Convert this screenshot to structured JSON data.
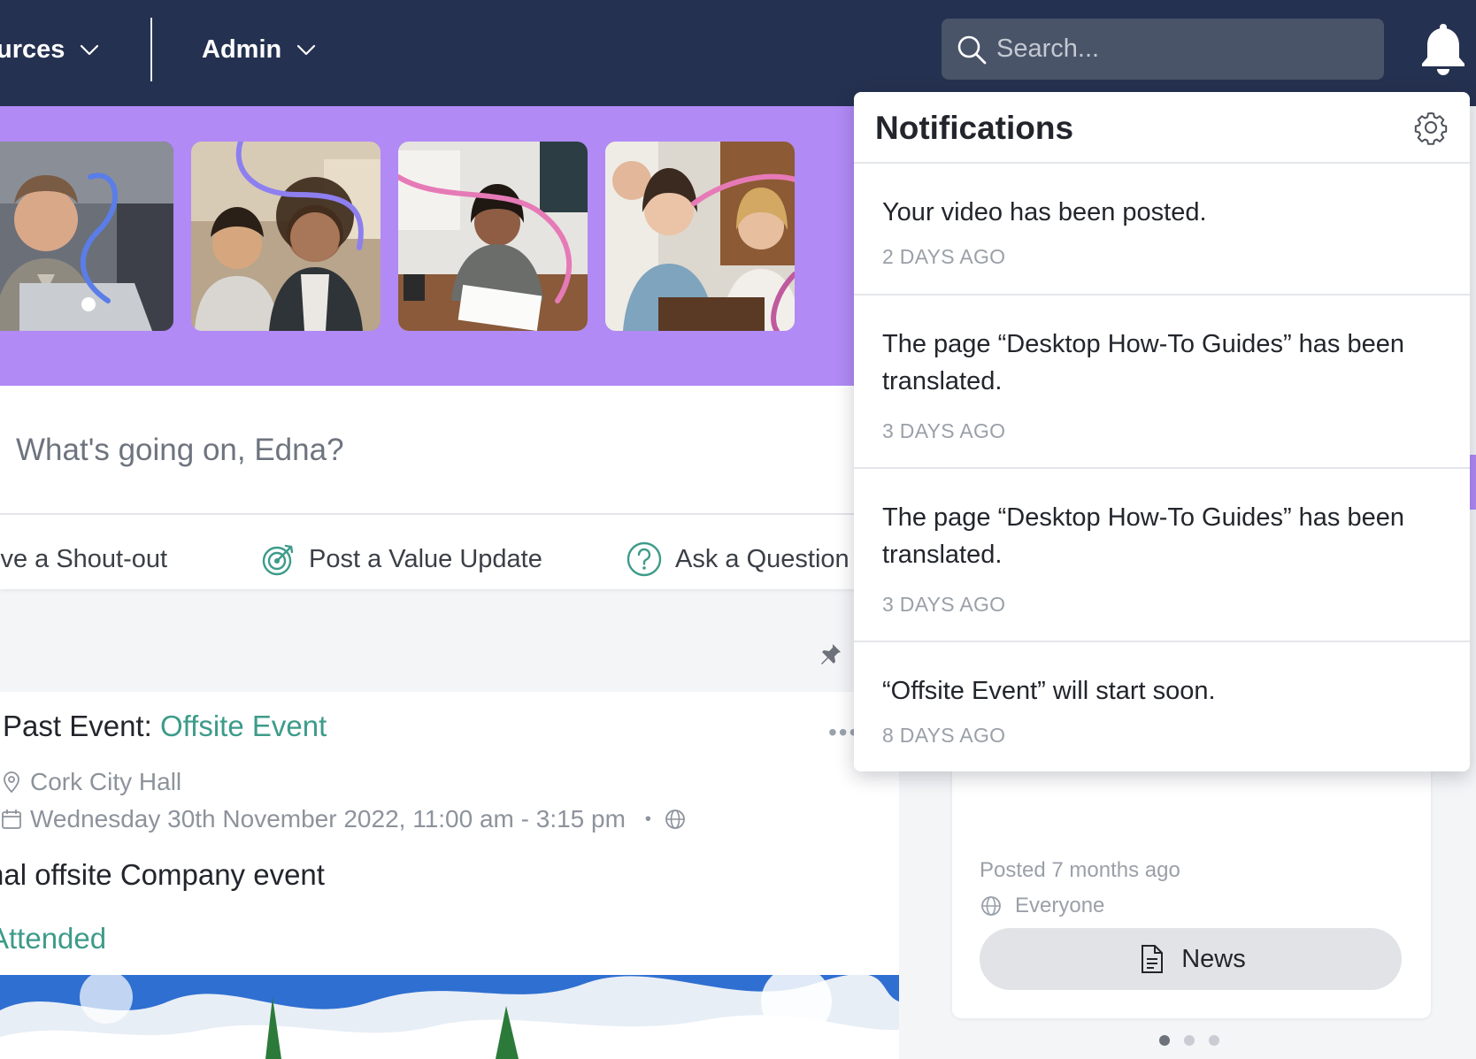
{
  "nav": {
    "items": [
      {
        "label": "urces"
      },
      {
        "label": "Admin"
      }
    ],
    "search_placeholder": "Search..."
  },
  "composer": {
    "placeholder": "What's going on, Edna?",
    "actions": [
      {
        "label": "ive a Shout-out"
      },
      {
        "label": "Post a Value Update"
      },
      {
        "label": "Ask a Question"
      }
    ]
  },
  "post": {
    "title_prefix": "Past Event: ",
    "title_link": "Offsite Event",
    "location": "Cork City Hall",
    "datetime": "Wednesday 30th November 2022, 11:00 am - 3:15 pm",
    "separator": "•",
    "description": "nal offsite Company event",
    "status": "Attended"
  },
  "card": {
    "posted": "Posted 7 months ago",
    "audience": "Everyone",
    "button_label": "News",
    "carousel_count": 3,
    "carousel_active": 0
  },
  "notifications": {
    "title": "Notifications",
    "items": [
      {
        "message": "Your video has been posted.",
        "time": "2 DAYS AGO"
      },
      {
        "message": "The page “Desktop How-To Guides” has been translated.",
        "time": "3 DAYS AGO"
      },
      {
        "message": "The page “Desktop How-To Guides” has been translated.",
        "time": "3 DAYS AGO"
      },
      {
        "message": "“Offsite Event” will start soon.",
        "time": "8 DAYS AGO"
      }
    ]
  },
  "colors": {
    "nav_bg": "#253150",
    "banner": "#b18af5",
    "accent_teal": "#3d9b8a"
  }
}
